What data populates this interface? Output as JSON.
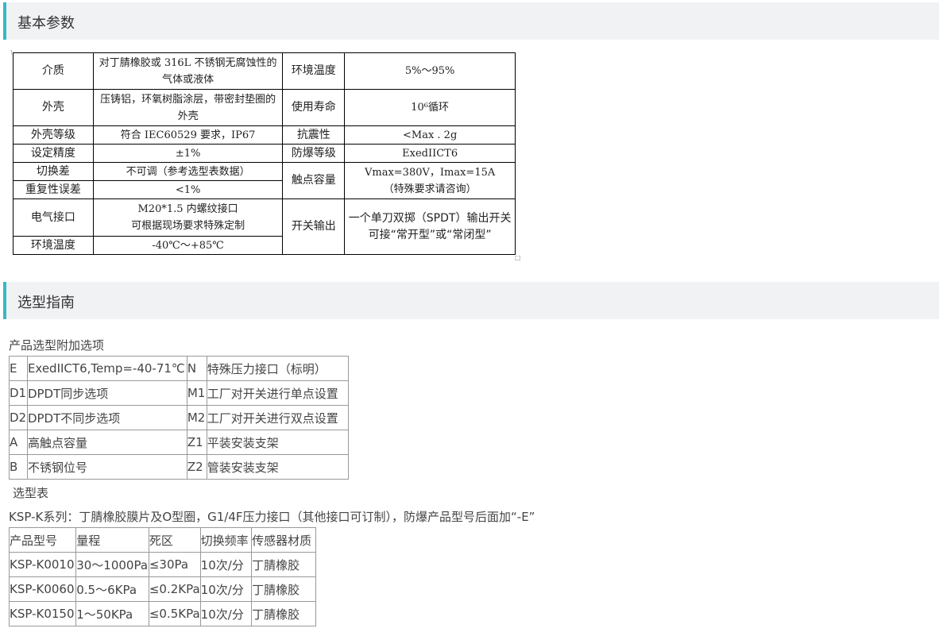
{
  "section1": {
    "title": "基本参数"
  },
  "params": {
    "medium_label": "介质",
    "medium_value": "对丁腈橡胶或 316L 不锈钢无腐蚀性的气体或液体",
    "env_humidity_label": "环境温度",
    "env_humidity_value": "5%～95%",
    "housing_label": "外壳",
    "housing_value": "压铸铝，环氧树脂涂层，带密封垫圈的外壳",
    "life_label": "使用寿命",
    "life_value": "10⁶循环",
    "housing_grade_label": "外壳等级",
    "housing_grade_value": "符合 IEC60529 要求，IP67",
    "shock_label": "抗震性",
    "shock_value": "<Max . 2g",
    "accuracy_label": "设定精度",
    "accuracy_value": "±1%",
    "explosion_label": "防爆等级",
    "explosion_value": "ExedIICT6",
    "switch_diff_label": "切换差",
    "switch_diff_value": "不可调（参考选型表数据）",
    "contact_label": "触点容量",
    "contact_value_1": "Vmax=380V，Imax=15A",
    "contact_value_2": "（特殊要求请咨询）",
    "repeat_label": "重复性误差",
    "repeat_value": "<1%",
    "electric_label": "电气接口",
    "electric_value_1": "M20*1.5 内螺纹接口",
    "electric_value_2": "可根据现场要求特殊定制",
    "output_label": "开关输出",
    "output_value": "一个单刀双掷（SPDT）输出开关可接“常开型”或“常闭型”",
    "env_temp_label": "环境温度",
    "env_temp_value": "-40℃～+85℃"
  },
  "section2": {
    "title": "选型指南"
  },
  "options_caption": "产品选型附加选项",
  "options": [
    {
      "c1": "E",
      "d1": "ExedIICT6,Temp=-40-71℃",
      "c2": "N",
      "d2": "特殊压力接口（标明）"
    },
    {
      "c1": "D1",
      "d1": "DPDT同步选项",
      "c2": "M1",
      "d2": "工厂对开关进行单点设置"
    },
    {
      "c1": "D2",
      "d1": "DPDT不同步选项",
      "c2": "M2",
      "d2": "工厂对开关进行双点设置"
    },
    {
      "c1": "A",
      "d1": "高触点容量",
      "c2": "Z1",
      "d2": "平装安装支架"
    },
    {
      "c1": "B",
      "d1": "不锈钢位号",
      "c2": "Z2",
      "d2": "管装安装支架"
    }
  ],
  "selection_caption": "选型表",
  "series_note": "KSP-K系列：丁腈橡胶膜片及O型圈，G1/4F压力接口（其他接口可订制），防爆产品型号后面加“-E”",
  "selection": {
    "headers": [
      "产品型号",
      "量程",
      "死区",
      "切换频率",
      "传感器材质"
    ],
    "rows": [
      [
        "KSP-K0010",
        "30～1000Pa",
        "≤30Pa",
        "10次/分",
        "丁腈橡胶"
      ],
      [
        "KSP-K0060",
        "0.5～6KPa",
        "≤0.2KPa",
        "10次/分",
        "丁腈橡胶"
      ],
      [
        "KSP-K0150",
        "1～50KPa",
        "≤0.5KPa",
        "10次/分",
        "丁腈橡胶"
      ]
    ]
  }
}
